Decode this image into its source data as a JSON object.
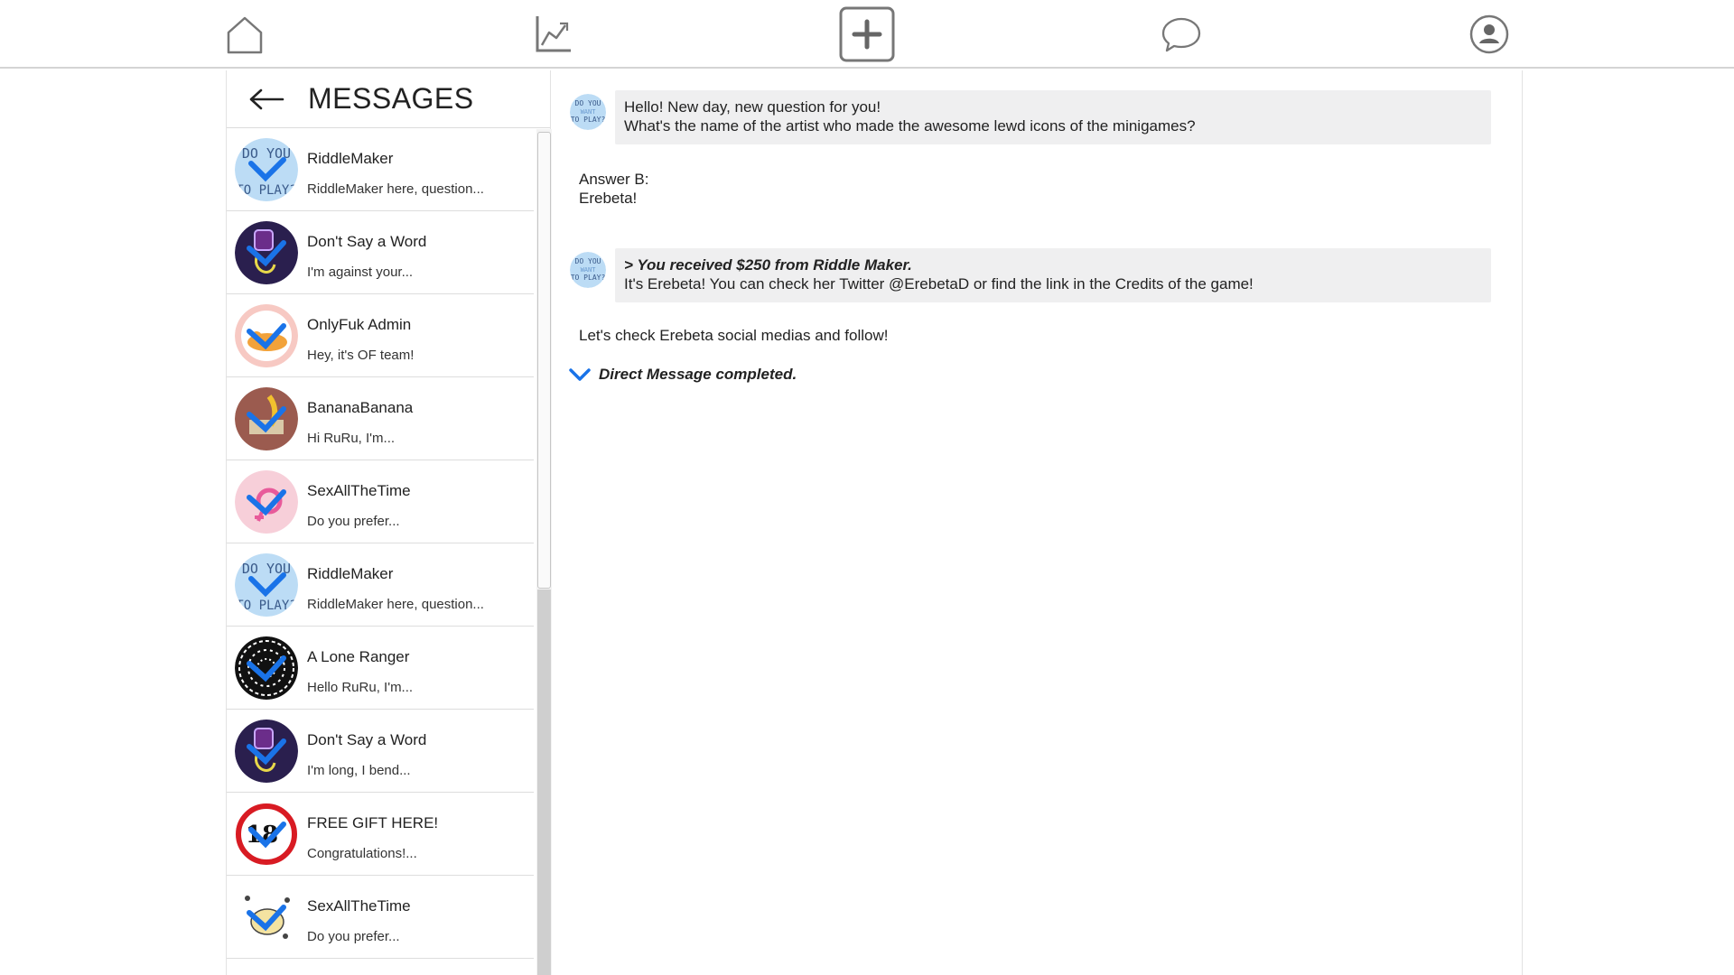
{
  "nav": {
    "items": [
      "home-icon",
      "stats-icon",
      "add-icon",
      "chat-icon",
      "profile-icon"
    ]
  },
  "sidebar": {
    "title": "MESSAGES",
    "contacts": [
      {
        "name": "RiddleMaker",
        "preview": "RiddleMaker here, question...",
        "avatar": "riddle"
      },
      {
        "name": "Don't Say a Word",
        "preview": "I'm against your...",
        "avatar": "neon"
      },
      {
        "name": "OnlyFuk Admin",
        "preview": "Hey, it's OF team!",
        "avatar": "onlyfuk"
      },
      {
        "name": "BananaBanana",
        "preview": "Hi RuRu, I'm...",
        "avatar": "banana"
      },
      {
        "name": "SexAllTheTime",
        "preview": "Do you prefer...",
        "avatar": "pink"
      },
      {
        "name": "RiddleMaker",
        "preview": "RiddleMaker here, question...",
        "avatar": "riddle"
      },
      {
        "name": "A Lone Ranger",
        "preview": "Hello RuRu, I'm...",
        "avatar": "ranger"
      },
      {
        "name": "Don't Say a Word",
        "preview": "I'm long, I bend...",
        "avatar": "neon"
      },
      {
        "name": "FREE GIFT HERE!",
        "preview": "Congratulations!...",
        "avatar": "gift"
      },
      {
        "name": "SexAllTheTime",
        "preview": "Do you prefer...",
        "avatar": "sketch"
      }
    ]
  },
  "chat": {
    "msg1_line1": "Hello! New day, new question for you!",
    "msg1_line2": "What's the name of the artist who made the awesome lewd icons of the minigames?",
    "answer_line1": "Answer B:",
    "answer_line2": "Erebeta!",
    "msg2_line1": "> You received $250 from Riddle Maker.",
    "msg2_line2": "It's Erebeta! You can check her Twitter @ErebetaD or find the link in the Credits of the game!",
    "reply": "Let's check Erebeta social medias and follow!",
    "status": "Direct Message completed."
  },
  "colors": {
    "accent_blue": "#1a73e8",
    "bubble_bg": "#efeff0",
    "avatar_riddle_bg": "#bcdcf5"
  }
}
